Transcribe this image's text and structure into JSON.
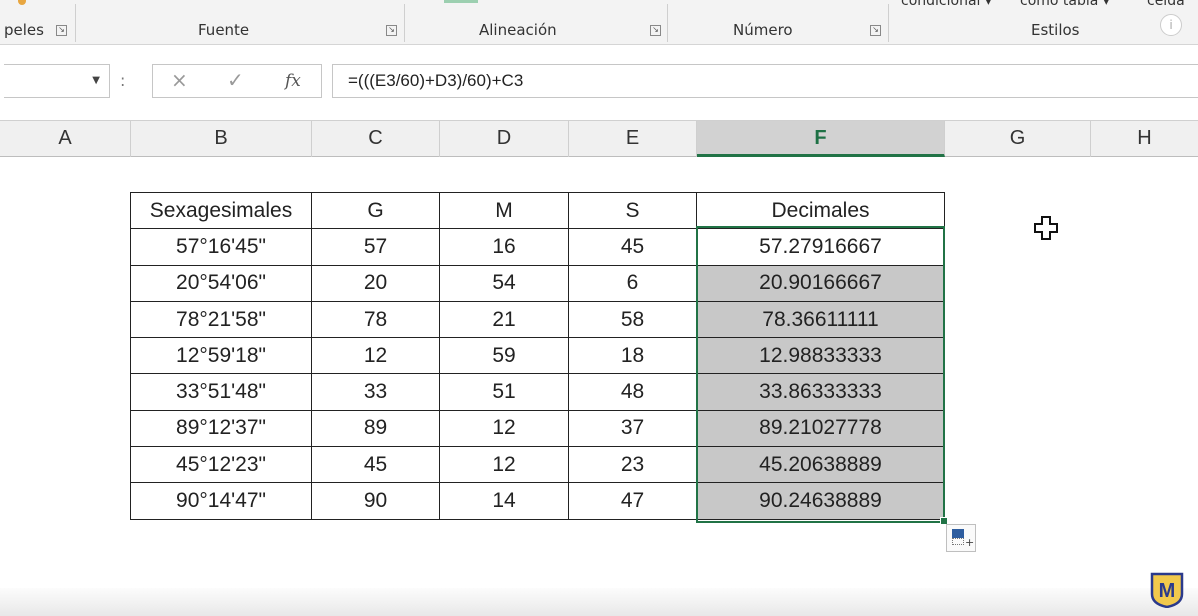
{
  "ribbon": {
    "groups": [
      {
        "label": "peles"
      },
      {
        "label": "Fuente"
      },
      {
        "label": "Alineación"
      },
      {
        "label": "Número"
      },
      {
        "label": "Estilos"
      }
    ],
    "top_cut_labels": [
      "condicional ▾",
      "como tabla ▾",
      "celda"
    ],
    "info_icon": "i"
  },
  "formula_bar": {
    "name_box_value": "",
    "more_dots": ":",
    "cancel_icon": "×",
    "enter_icon": "✓",
    "fx_label": "fx",
    "formula": "=(((E3/60)+D3)/60)+C3"
  },
  "columns": [
    "A",
    "B",
    "C",
    "D",
    "E",
    "F",
    "G",
    "H"
  ],
  "active_column": "F",
  "table": {
    "headers": [
      "Sexagesimales",
      "G",
      "M",
      "S",
      "Decimales"
    ],
    "rows": [
      [
        "57°16'45\"",
        "57",
        "16",
        "45",
        "57.27916667"
      ],
      [
        "20°54'06\"",
        "20",
        "54",
        "6",
        "20.90166667"
      ],
      [
        "78°21'58\"",
        "78",
        "21",
        "58",
        "78.36611111"
      ],
      [
        "12°59'18\"",
        "12",
        "59",
        "18",
        "12.98833333"
      ],
      [
        "33°51'48\"",
        "33",
        "51",
        "48",
        "33.86333333"
      ],
      [
        "89°12'37\"",
        "89",
        "12",
        "37",
        "89.21027778"
      ],
      [
        "45°12'23\"",
        "45",
        "12",
        "23",
        "45.20638889"
      ],
      [
        "90°14'47\"",
        "90",
        "14",
        "47",
        "90.24638889"
      ]
    ]
  },
  "colors": {
    "excel_green": "#217346",
    "selection_fill": "#c8c8c8",
    "logo_blue": "#2b3a8c",
    "logo_gold": "#f2c94c"
  },
  "logo": {
    "letter": "M"
  }
}
